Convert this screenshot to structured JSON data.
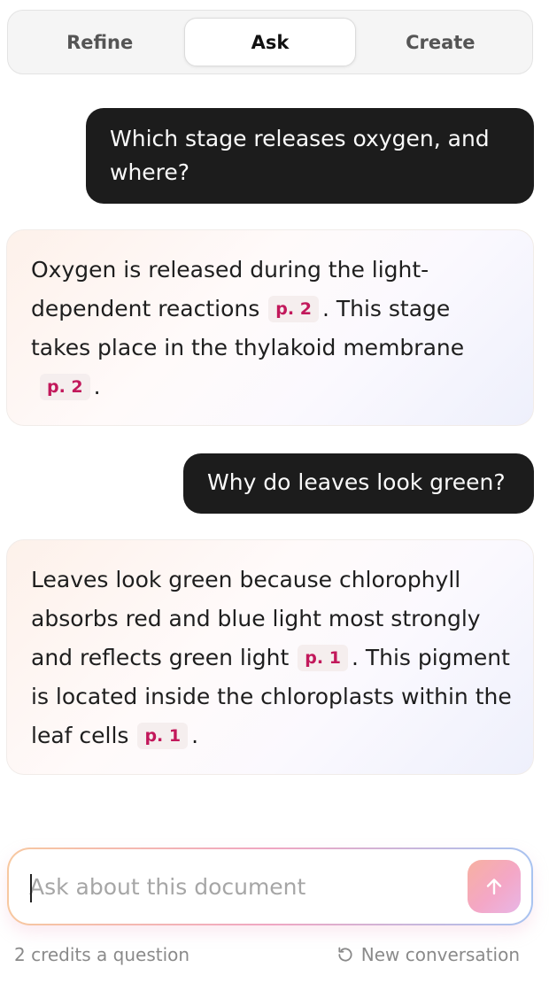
{
  "tabs": [
    {
      "label": "Refine",
      "active": false
    },
    {
      "label": "Ask",
      "active": true
    },
    {
      "label": "Create",
      "active": false
    }
  ],
  "conversation": {
    "q1": "Which stage releases oxygen, and where?",
    "a1": {
      "t1": "Oxygen is released during the light-dependent reactions",
      "c1": "p. 2",
      "t2": ". This stage takes place in the thylakoid membrane",
      "c2": "p. 2",
      "t3": "."
    },
    "q2": "Why do leaves look green?",
    "a2": {
      "t1": "Leaves look green because chlorophyll absorbs red and blue light most strongly and reflects green light",
      "c1": "p. 1",
      "t2": ". This pigment is located inside the chloroplasts within the leaf cells",
      "c2": "p. 1",
      "t3": "."
    }
  },
  "composer": {
    "placeholder": "Ask about this document",
    "send_icon": "arrow-up-icon"
  },
  "footer": {
    "credits": "2 credits a question",
    "new_conversation": "New conversation",
    "new_conversation_icon": "rotate-ccw-icon"
  },
  "colors": {
    "user_bubble": "#1c1c1c",
    "citation_text": "#c2185b",
    "citation_bg": "#f5eeee"
  }
}
